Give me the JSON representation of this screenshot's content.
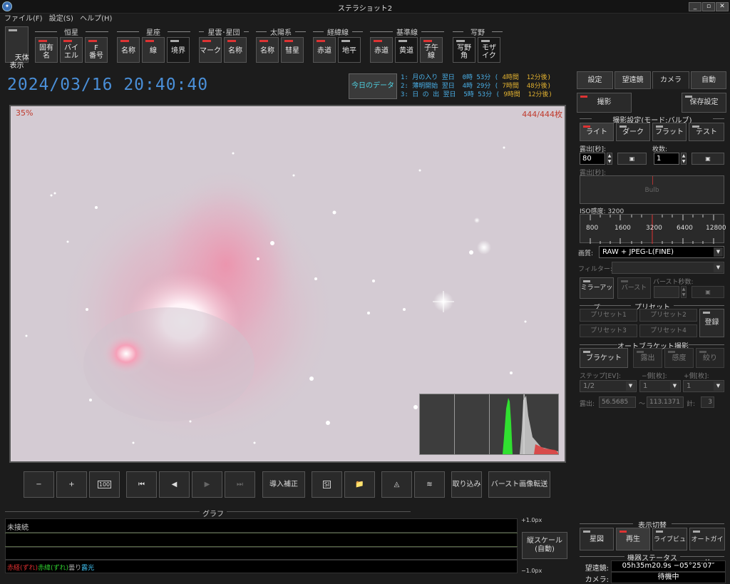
{
  "window": {
    "title": "ステラショット2",
    "icon": "app-icon",
    "controls": [
      "_",
      "▫",
      "✕"
    ]
  },
  "menu": [
    "ファイル(F)",
    "設定(S)",
    "ヘルプ(H)"
  ],
  "toolbar": {
    "tenkyu": "天体\n表示",
    "groups": [
      {
        "label": "恒星",
        "buttons": [
          "固有\n名",
          "バイ\nエル",
          "F\n番号"
        ]
      },
      {
        "label": "星座",
        "buttons": [
          "名称",
          "線",
          "境界"
        ]
      },
      {
        "label": "星雲･星団",
        "buttons": [
          "マーク",
          "名称"
        ]
      },
      {
        "label": "太陽系",
        "buttons": [
          "名称",
          "彗星"
        ]
      },
      {
        "label": "経緯線",
        "buttons": [
          "赤道",
          "地平"
        ]
      },
      {
        "label": "基準線",
        "buttons": [
          "赤道",
          "黄道",
          "子午\n線"
        ]
      },
      {
        "label": "写野",
        "buttons": [
          "写野\n角",
          "モザ\nイク"
        ]
      }
    ]
  },
  "datetime": "2024/03/16  20:40:40",
  "today_button": "今日のデータ",
  "events": [
    {
      "num": "1:",
      "name": "月の入り",
      "day": "翌日",
      "time": "0時 53分 (",
      "rel": "4時間  12分後)"
    },
    {
      "num": "2:",
      "name": "薄明開始",
      "day": "翌日",
      "time": "4時 29分 (",
      "rel": "7時間  48分後)"
    },
    {
      "num": "3:",
      "name": "日 の 出",
      "day": "翌日",
      "time": "5時 53分 (",
      "rel": "9時間  12分後)"
    }
  ],
  "image": {
    "zoom": "35%",
    "count": "444/444枚"
  },
  "controls": {
    "zoom_out": "−",
    "zoom_in": "+",
    "fit": "100",
    "first": "⏮",
    "prev": "◀",
    "play": "▶",
    "last": "⏭",
    "intro": "導入補正",
    "si": "SI",
    "folder": "📁",
    "histo": "◬",
    "graph": "≋",
    "import": "取り込み",
    "burst": "バースト画像転送"
  },
  "graph": {
    "title": "グラフ",
    "status": "未接続",
    "top_scale": "+1.0px",
    "bottom_scale": "−1.0px",
    "vscale": "縦スケール\n(自動)",
    "legend": [
      {
        "text": "赤経(ずれ)",
        "color": "#e03030"
      },
      {
        "text": "赤緯(ずれ)",
        "color": "#30d030"
      },
      {
        "text": "曇り",
        "color": "#aaaaaa"
      },
      {
        "text": "露光",
        "color": "#40c0f0"
      }
    ]
  },
  "sidebar": {
    "tabs": [
      "設定",
      "望遠鏡",
      "カメラ",
      "自動"
    ],
    "active_tab": "カメラ",
    "shoot": "撮影",
    "save_settings": "保存設定",
    "capture_header": "撮影設定(モード:バルブ)",
    "modes": [
      "ライト",
      "ダーク",
      "フラット",
      "テスト"
    ],
    "exposure_label": "露出[秒]:",
    "exposure_value": "80",
    "frames_label": "枚数:",
    "frames_value": "1",
    "exposure_label2": "露出[秒]:",
    "bulb": "Bulb",
    "iso_label": "ISO感度: 3200",
    "iso_ticks": [
      "800",
      "1600",
      "3200",
      "6400",
      "12800"
    ],
    "quality_label": "画質:",
    "quality_value": "RAW + JPEG-L(FINE)",
    "filter_label": "フィルター:",
    "mirrorup": "ミラーアップ",
    "burst": "バースト",
    "burst_sec": "バースト秒数:",
    "preset_header": "プリセット",
    "presets": [
      "プリセット1",
      "プリセット2",
      "プリセット3",
      "プリセット4"
    ],
    "register": "登録",
    "bracket_header": "オートブラケット撮影",
    "bracket_buttons": [
      "ブラケット",
      "露出",
      "感度",
      "絞り"
    ],
    "step_label": "ステップ[EV]:",
    "minus_label": "−側[枚]:",
    "plus_label": "+側[枚]:",
    "step_value": "1/2",
    "minus_value": "1",
    "plus_value": "1",
    "exp_label": "露出:",
    "exp_from": "56.5685",
    "exp_tilde": "〜",
    "exp_to": "113.1371",
    "total_label": "計:",
    "total_value": "3",
    "display_header": "表示切替",
    "display_buttons": [
      "星図",
      "再生",
      "ライブビュー",
      "オートガイド"
    ],
    "status_header": "機器ステータス",
    "telescope_label": "望遠鏡:",
    "telescope_value": "05h35m20.9s −05°25′07″",
    "camera_label": "カメラ:",
    "camera_value": "待機中"
  }
}
